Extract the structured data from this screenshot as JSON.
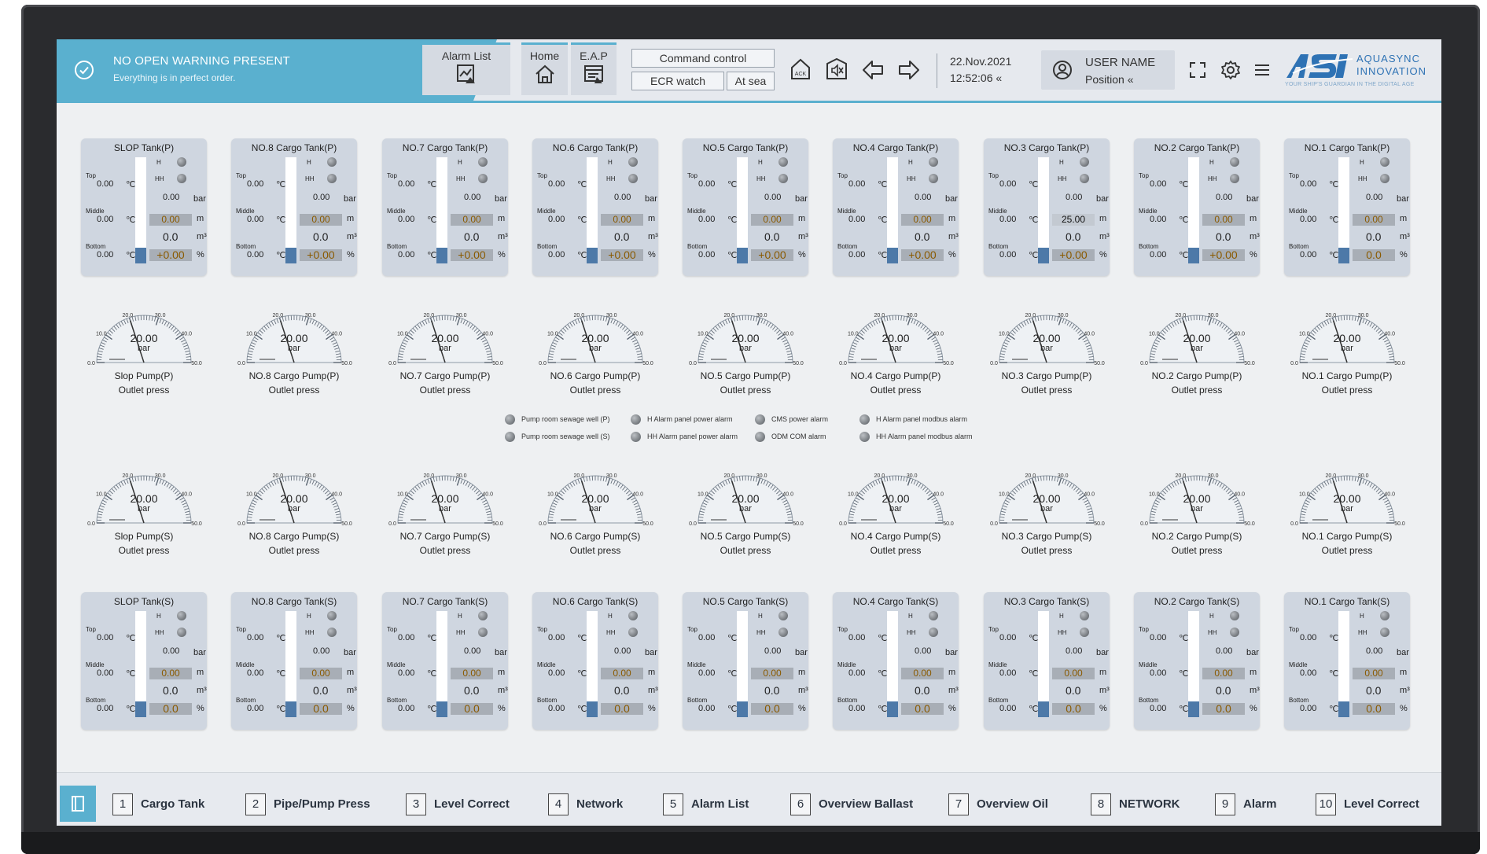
{
  "warning": {
    "title": "NO OPEN WARNING PRESENT",
    "subtitle": "Everything is in perfect order."
  },
  "nav": {
    "alarm_list": "Alarm List",
    "home": "Home",
    "eap": "E.A.P"
  },
  "command": {
    "control": "Command control",
    "ecr_watch": "ECR watch",
    "at_sea": "At sea"
  },
  "datetime": {
    "date": "22.Nov.2021",
    "time": "12:52:06 «"
  },
  "user": {
    "name": "USER NAME",
    "position": "Position «"
  },
  "logo": {
    "line1": "AQUASYNC",
    "line2": "INNOVATION",
    "tagline": "YOUR SHIP'S GUARDIAN IN THE DIGITAL AGE",
    "brand": "ASI"
  },
  "tank_labels": {
    "top": "Top",
    "middle": "Middle",
    "bottom": "Bottom",
    "h": "H",
    "hh": "HH",
    "temp_unit": "℃",
    "bar": "bar",
    "m": "m",
    "m3": "m³",
    "pct": "%"
  },
  "tanks_p": [
    {
      "name": "SLOP Tank(P)",
      "top": "0.00",
      "middle": "0.00",
      "bottom": "0.00",
      "press": "0.00",
      "level": "0.00",
      "volume": "0.0",
      "percent": "+0.00"
    },
    {
      "name": "NO.8 Cargo Tank(P)",
      "top": "0.00",
      "middle": "0.00",
      "bottom": "0.00",
      "press": "0.00",
      "level": "0.00",
      "volume": "0.0",
      "percent": "+0.00"
    },
    {
      "name": "NO.7 Cargo Tank(P)",
      "top": "0.00",
      "middle": "0.00",
      "bottom": "0.00",
      "press": "0.00",
      "level": "0.00",
      "volume": "0.0",
      "percent": "+0.00"
    },
    {
      "name": "NO.6 Cargo Tank(P)",
      "top": "0.00",
      "middle": "0.00",
      "bottom": "0.00",
      "press": "0.00",
      "level": "0.00",
      "volume": "0.0",
      "percent": "+0.00"
    },
    {
      "name": "NO.5 Cargo Tank(P)",
      "top": "0.00",
      "middle": "0.00",
      "bottom": "0.00",
      "press": "0.00",
      "level": "0.00",
      "volume": "0.0",
      "percent": "+0.00"
    },
    {
      "name": "NO.4 Cargo Tank(P)",
      "top": "0.00",
      "middle": "0.00",
      "bottom": "0.00",
      "press": "0.00",
      "level": "0.00",
      "volume": "0.0",
      "percent": "+0.00"
    },
    {
      "name": "NO.3 Cargo Tank(P)",
      "top": "0.00",
      "middle": "0.00",
      "bottom": "0.00",
      "press": "0.00",
      "level": "25.00",
      "volume": "0.0",
      "percent": "+0.00"
    },
    {
      "name": "NO.2 Cargo Tank(P)",
      "top": "0.00",
      "middle": "0.00",
      "bottom": "0.00",
      "press": "0.00",
      "level": "0.00",
      "volume": "0.0",
      "percent": "+0.00"
    },
    {
      "name": "NO.1 Cargo Tank(P)",
      "top": "0.00",
      "middle": "0.00",
      "bottom": "0.00",
      "press": "0.00",
      "level": "0.00",
      "volume": "0.0",
      "percent": "0.0"
    }
  ],
  "tanks_s": [
    {
      "name": "SLOP Tank(S)",
      "top": "0.00",
      "middle": "0.00",
      "bottom": "0.00",
      "press": "0.00",
      "level": "0.00",
      "volume": "0.0",
      "percent": "0.0"
    },
    {
      "name": "NO.8 Cargo Tank(S)",
      "top": "0.00",
      "middle": "0.00",
      "bottom": "0.00",
      "press": "0.00",
      "level": "0.00",
      "volume": "0.0",
      "percent": "0.0"
    },
    {
      "name": "NO.7 Cargo Tank(S)",
      "top": "0.00",
      "middle": "0.00",
      "bottom": "0.00",
      "press": "0.00",
      "level": "0.00",
      "volume": "0.0",
      "percent": "0.0"
    },
    {
      "name": "NO.6 Cargo Tank(S)",
      "top": "0.00",
      "middle": "0.00",
      "bottom": "0.00",
      "press": "0.00",
      "level": "0.00",
      "volume": "0.0",
      "percent": "0.0"
    },
    {
      "name": "NO.5 Cargo Tank(S)",
      "top": "0.00",
      "middle": "0.00",
      "bottom": "0.00",
      "press": "0.00",
      "level": "0.00",
      "volume": "0.0",
      "percent": "0.0"
    },
    {
      "name": "NO.4 Cargo Tank(S)",
      "top": "0.00",
      "middle": "0.00",
      "bottom": "0.00",
      "press": "0.00",
      "level": "0.00",
      "volume": "0.0",
      "percent": "0.0"
    },
    {
      "name": "NO.3 Cargo Tank(S)",
      "top": "0.00",
      "middle": "0.00",
      "bottom": "0.00",
      "press": "0.00",
      "level": "0.00",
      "volume": "0.0",
      "percent": "0.0"
    },
    {
      "name": "NO.2 Cargo Tank(S)",
      "top": "0.00",
      "middle": "0.00",
      "bottom": "0.00",
      "press": "0.00",
      "level": "0.00",
      "volume": "0.0",
      "percent": "0.0"
    },
    {
      "name": "NO.1 Cargo Tank(S)",
      "top": "0.00",
      "middle": "0.00",
      "bottom": "0.00",
      "press": "0.00",
      "level": "0.00",
      "volume": "0.0",
      "percent": "0.0"
    }
  ],
  "gauge_scale": {
    "ticks": [
      "0.0",
      "10.0",
      "20.0",
      "30.0",
      "40.0",
      "50.0"
    ],
    "min": 0,
    "max": 50,
    "unit": "bar",
    "outlet": "Outlet press"
  },
  "pumps_p": [
    {
      "name": "Slop Pump(P)",
      "value": "20.00",
      "reading": 20
    },
    {
      "name": "NO.8 Cargo Pump(P)",
      "value": "20.00",
      "reading": 20
    },
    {
      "name": "NO.7 Cargo Pump(P)",
      "value": "20.00",
      "reading": 20
    },
    {
      "name": "NO.6 Cargo Pump(P)",
      "value": "20.00",
      "reading": 20
    },
    {
      "name": "NO.5 Cargo Pump(P)",
      "value": "20.00",
      "reading": 20
    },
    {
      "name": "NO.4 Cargo Pump(P)",
      "value": "20.00",
      "reading": 20
    },
    {
      "name": "NO.3 Cargo Pump(P)",
      "value": "20.00",
      "reading": 20
    },
    {
      "name": "NO.2 Cargo Pump(P)",
      "value": "20.00",
      "reading": 20
    },
    {
      "name": "NO.1 Cargo Pump(P)",
      "value": "20.00",
      "reading": 20
    }
  ],
  "pumps_s": [
    {
      "name": "Slop Pump(S)",
      "value": "20.00",
      "reading": 20
    },
    {
      "name": "NO.8 Cargo Pump(S)",
      "value": "20.00",
      "reading": 20
    },
    {
      "name": "NO.7 Cargo Pump(S)",
      "value": "20.00",
      "reading": 20
    },
    {
      "name": "NO.6 Cargo Pump(S)",
      "value": "20.00",
      "reading": 20
    },
    {
      "name": "NO.5 Cargo Pump(S)",
      "value": "20.00",
      "reading": 20
    },
    {
      "name": "NO.4 Cargo Pump(S)",
      "value": "20.00",
      "reading": 20
    },
    {
      "name": "NO.3 Cargo Pump(S)",
      "value": "20.00",
      "reading": 20
    },
    {
      "name": "NO.2 Cargo Pump(S)",
      "value": "20.00",
      "reading": 20
    },
    {
      "name": "NO.1 Cargo Pump(S)",
      "value": "20.00",
      "reading": 20
    }
  ],
  "alarms": [
    "Pump room sewage well (P)",
    "Pump room sewage well (S)",
    "H Alarm panel power alarm",
    "HH Alarm panel power alarm",
    "CMS power alarm",
    "ODM COM alarm",
    "H Alarm panel modbus alarm",
    "HH Alarm panel modbus alarm"
  ],
  "bottom_nav": [
    {
      "num": "1",
      "label": "Cargo Tank"
    },
    {
      "num": "2",
      "label": "Pipe/Pump Press"
    },
    {
      "num": "3",
      "label": "Level Correct"
    },
    {
      "num": "4",
      "label": "Network"
    },
    {
      "num": "5",
      "label": "Alarm List"
    },
    {
      "num": "6",
      "label": "Overview Ballast"
    },
    {
      "num": "7",
      "label": "Overview Oil"
    },
    {
      "num": "8",
      "label": "NETWORK"
    },
    {
      "num": "9",
      "label": "Alarm"
    },
    {
      "num": "10",
      "label": "Level Correct"
    }
  ],
  "colors": {
    "accent": "#5ab0cf",
    "tank_bg": "#cfd6e0",
    "level_fill": "#4d79a8",
    "brand": "#2e72b4"
  },
  "icons": [
    "check-circle-icon",
    "alarm-chart-icon",
    "home-icon",
    "eap-icon",
    "ack-icon",
    "mute-icon",
    "back-arrow-icon",
    "forward-arrow-icon",
    "user-icon",
    "fullscreen-icon",
    "gear-icon",
    "menu-icon",
    "book-icon"
  ]
}
